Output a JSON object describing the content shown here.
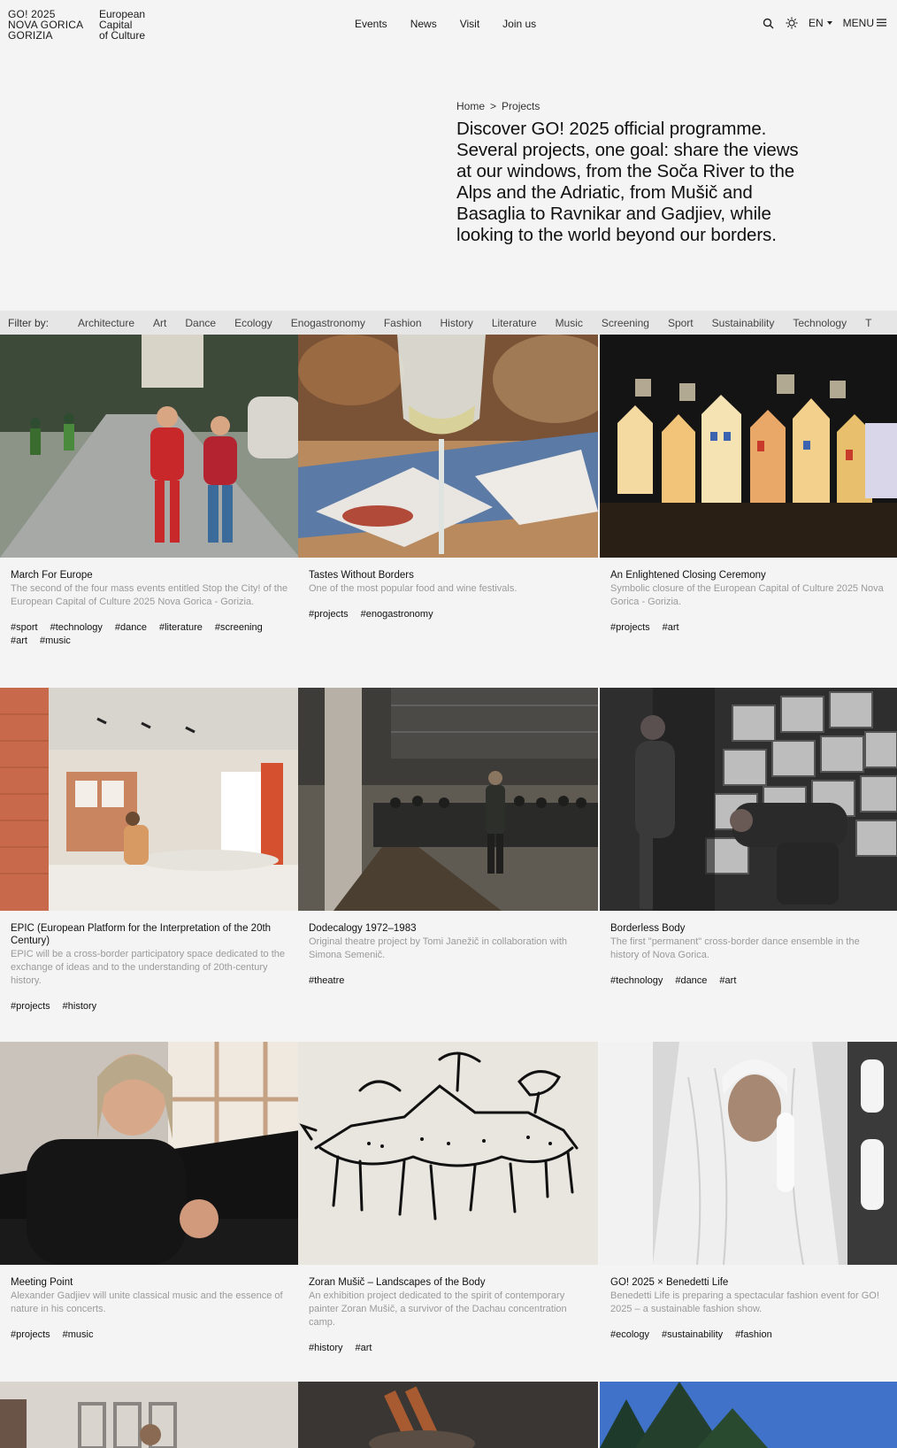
{
  "header": {
    "logo_lines": [
      "GO! 2025",
      "NOVA GORICA",
      "GORIZIA"
    ],
    "logo_sub_lines": [
      "European",
      "Capital",
      "of Culture"
    ],
    "nav": [
      "Events",
      "News",
      "Visit",
      "Join us"
    ],
    "language": "EN",
    "menu_label": "MENU"
  },
  "breadcrumb": {
    "home": "Home",
    "separator": ">",
    "current": "Projects"
  },
  "hero": {
    "text": "Discover GO! 2025 official programme. Several projects, one goal: share the views at our windows, from the Soča River to the Alps and the Adriatic, from Mušič and Basaglia to Ravnikar and Gadjiev, while looking to the world beyond our borders."
  },
  "filter": {
    "label": "Filter by:",
    "items": [
      "Architecture",
      "Art",
      "Dance",
      "Ecology",
      "Enogastronomy",
      "Fashion",
      "History",
      "Literature",
      "Music",
      "Screening",
      "Sport",
      "Sustainability",
      "Technology",
      "T"
    ]
  },
  "cards": [
    {
      "title": "March For Europe",
      "desc": "The second of the four mass events entitled Stop the City! of the European Capital of Culture 2025 Nova Gorica - Gorizia.",
      "tags": [
        "#sport",
        "#technology",
        "#dance",
        "#literature",
        "#screening",
        "#art",
        "#music"
      ]
    },
    {
      "title": "Tastes Without Borders",
      "desc": "One of the most popular food and wine festivals.",
      "tags": [
        "#projects",
        "#enogastronomy"
      ]
    },
    {
      "title": "An Enlightened Closing Ceremony",
      "desc": "Symbolic closure of the European Capital of Culture 2025 Nova Gorica - Gorizia.",
      "tags": [
        "#projects",
        "#art"
      ]
    },
    {
      "title": "EPIC (European Platform for the Interpretation of the 20th Century)",
      "desc": "EPIC will be a cross-border participatory space dedicated to the exchange of ideas and to the understanding of 20th-century history.",
      "tags": [
        "#projects",
        "#history"
      ]
    },
    {
      "title": "Dodecalogy 1972–1983",
      "desc": "Original theatre project by Tomi Janežič in collaboration with Simona Semenič.",
      "tags": [
        "#theatre"
      ]
    },
    {
      "title": "Borderless Body",
      "desc": "The first \"permanent\" cross-border dance ensemble in the history of Nova Gorica.",
      "tags": [
        "#technology",
        "#dance",
        "#art"
      ]
    },
    {
      "title": "Meeting Point",
      "desc": "Alexander Gadjiev will unite classical music and the essence of nature in his concerts.",
      "tags": [
        "#projects",
        "#music"
      ]
    },
    {
      "title": "Zoran Mušič – Landscapes of the Body",
      "desc": "An exhibition project dedicated to the spirit of contemporary painter Zoran Mušič, a survivor of the Dachau concentration camp.",
      "tags": [
        "#history",
        "#art"
      ]
    },
    {
      "title": "GO! 2025 × Benedetti Life",
      "desc": "Benedetti Life is preparing a spectacular fashion event for GO! 2025 – a sustainable fashion show.",
      "tags": [
        "#ecology",
        "#sustainability",
        "#fashion"
      ]
    }
  ]
}
